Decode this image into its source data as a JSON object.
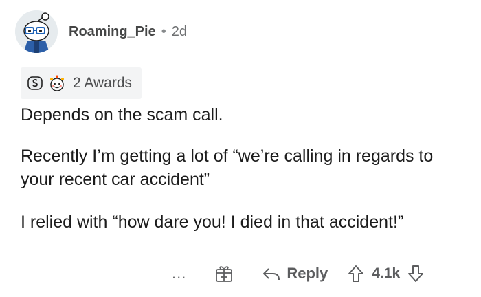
{
  "comment": {
    "username": "Roaming_Pie",
    "separator": "•",
    "age": "2d",
    "awards_label": "2 Awards",
    "paragraphs": [
      "Depends on the scam call.",
      "Recently I’m getting a lot of “we’re calling in regards to your recent car accident”",
      "I relied with “how dare you! I died in that accident!”"
    ]
  },
  "actions": {
    "more_label": "...",
    "reply_label": "Reply",
    "vote_count": "4.1k"
  },
  "icons": {
    "award1": "silver-award-icon",
    "award2": "wholesome-award-icon",
    "gift": "gift-icon",
    "reply": "reply-arrow-icon",
    "upvote": "upvote-arrow-icon",
    "downvote": "downvote-arrow-icon"
  }
}
